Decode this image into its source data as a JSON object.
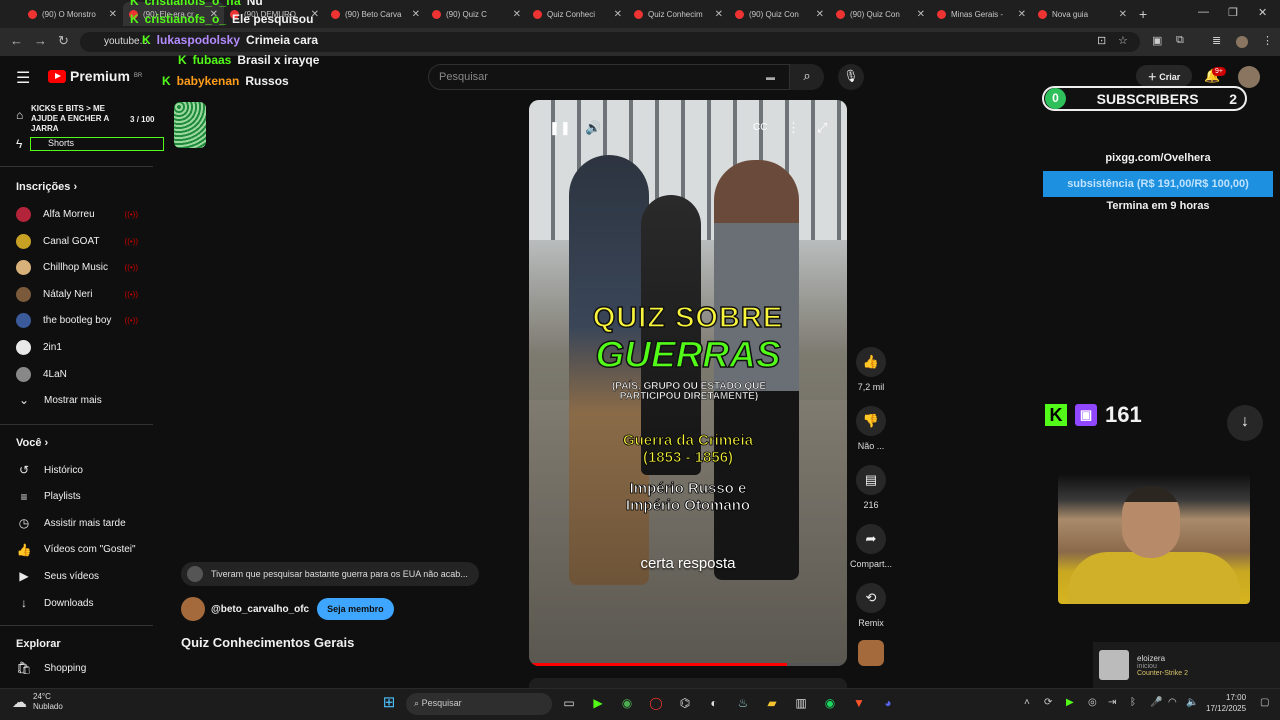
{
  "tabs": [
    {
      "label": "(90) O Monstro",
      "active": false
    },
    {
      "label": "(90) Ele era cr",
      "active": true
    },
    {
      "label": "(90) DEMURO",
      "active": false
    },
    {
      "label": "(90) Beto Carva",
      "active": false
    },
    {
      "label": "(90) Quiz C",
      "active": false
    },
    {
      "label": "Quiz Conheci",
      "active": false
    },
    {
      "label": "Quiz Conhecim",
      "active": false
    },
    {
      "label": "(90) Quiz Con",
      "active": false
    },
    {
      "label": "(90) Quiz Con",
      "active": false
    },
    {
      "label": "Minas Gerais -",
      "active": false
    },
    {
      "label": "Nova guia",
      "active": false
    }
  ],
  "browser": {
    "url": "youtube.c"
  },
  "chat": [
    {
      "user": "cristianofs_o_ffa",
      "msg": "Nu"
    },
    {
      "user": "cristianofs_o_",
      "msg": "Ele pesquisou"
    },
    {
      "user": "lukaspodolsky",
      "msg": "Crimeia cara",
      "color": "#b48cff"
    },
    {
      "user": "fubaas",
      "msg": "Brasil x irayqe",
      "color": "#53fc18"
    },
    {
      "user": "babykenan",
      "msg": "Russos",
      "color": "#ff9c1a"
    }
  ],
  "header": {
    "logo": "Premium",
    "logo_sup": "BR",
    "search_placeholder": "Pesquisar",
    "create_label": "Criar",
    "notif_count": "9+"
  },
  "jar": {
    "title": "KICKS E BITS > ME AJUDE A ENCHER A JARRA",
    "count": "3",
    "total": "/ 100"
  },
  "sidebar": {
    "home": "Início",
    "shorts": "Shorts",
    "subs_title": "Inscrições",
    "subscriptions": [
      {
        "name": "Alfa Morreu",
        "color": "#b3243a",
        "live": true
      },
      {
        "name": "Canal GOAT",
        "color": "#c7a024",
        "live": true
      },
      {
        "name": "Chillhop Music",
        "color": "#d8b07a",
        "live": true
      },
      {
        "name": "Nátaly Neri",
        "color": "#7a5a3a",
        "live": true
      },
      {
        "name": "the bootleg boy",
        "color": "#3a5a9a",
        "live": true
      },
      {
        "name": "2in1",
        "color": "#e8e8e8",
        "live": false
      },
      {
        "name": "4LaN",
        "color": "#888",
        "live": false
      }
    ],
    "show_more": "Mostrar mais",
    "you_title": "Você",
    "you_items": [
      {
        "icon": "history-icon",
        "glyph": "↺",
        "label": "Histórico"
      },
      {
        "icon": "playlist-icon",
        "glyph": "≡",
        "label": "Playlists"
      },
      {
        "icon": "clock-icon",
        "glyph": "◷",
        "label": "Assistir mais tarde"
      },
      {
        "icon": "like-icon",
        "glyph": "👍",
        "label": "Vídeos com \"Gostei\""
      },
      {
        "icon": "video-icon",
        "glyph": "▶",
        "label": "Seus vídeos"
      },
      {
        "icon": "download-icon",
        "glyph": "↓",
        "label": "Downloads"
      }
    ],
    "explore_title": "Explorar",
    "shopping": "Shopping"
  },
  "video": {
    "title_line1": "QUIZ SOBRE",
    "title_line2": "GUERRAS",
    "subtitle": "(PAÍS, GRUPO OU ESTADO QUE PARTICIPOU DIRETAMENTE)",
    "war_name": "Guerra da Crimeia",
    "war_years": "(1853 - 1856)",
    "answer_line1": "Império Russo e",
    "answer_line2": "Império Otomano",
    "caption": "certa resposta",
    "progress": 0.81
  },
  "actions": {
    "likes": "7,2 mil",
    "dislike": "Não ...",
    "comments": "216",
    "share": "Compart...",
    "remix": "Remix"
  },
  "comment_preview": "Tiveram que pesquisar bastante guerra para os EUA não acab...",
  "channel": {
    "handle": "@beto_carvalho_ofc",
    "member_btn": "Seja membro"
  },
  "video_title": "Quiz Conhecimentos Gerais",
  "overlay": {
    "subs_count": "0",
    "subs_label": "SUBSCRIBERS",
    "subs_goal": "2",
    "pix": "pixgg.com/Ovelhera",
    "goal": "subsistência (R$ 191,00/R$ 100,00)",
    "ends": "Termina em 9 horas",
    "kick_count": "161"
  },
  "notification": {
    "name": "eloizera",
    "status": "iniciou",
    "game": "Counter-Strike 2"
  },
  "taskbar": {
    "temp": "24°C",
    "weather": "Nublado",
    "search": "Pesquisar",
    "time": "17:00",
    "date": "17/12/2025"
  }
}
